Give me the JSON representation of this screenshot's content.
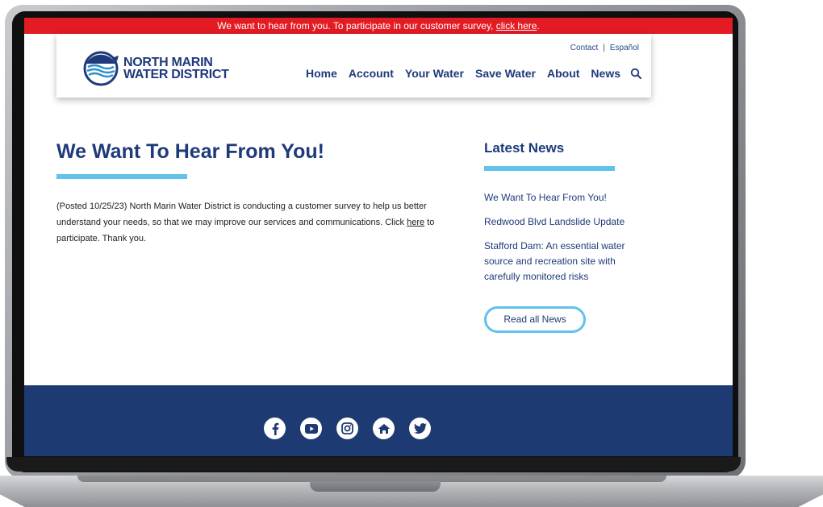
{
  "alert": {
    "text": "We want to hear from you. To participate in our customer survey, ",
    "link": "click here",
    "end": "."
  },
  "brand": {
    "line1": "NORTH MARIN",
    "line2": "WATER DISTRICT"
  },
  "utility_links": [
    "Contact",
    "Español"
  ],
  "nav": [
    "Home",
    "Account",
    "Your Water",
    "Save Water",
    "About",
    "News"
  ],
  "article": {
    "title": "We Want To Hear From You!",
    "body_start": "(Posted 10/25/23) North Marin Water District is conducting a customer survey to help us better understand your needs, so that we may improve our services and communications. Click ",
    "link": "here",
    "body_end": " to participate.  Thank you."
  },
  "sidebar": {
    "title": "Latest News",
    "items": [
      "We Want To Hear From You!",
      "Redwood Blvd Landslide Update",
      "Stafford Dam: An essential water source and recreation site with carefully monitored risks"
    ],
    "button": "Read all News"
  },
  "footer": {
    "socials": [
      "facebook-icon",
      "youtube-icon",
      "instagram-icon",
      "nextdoor-icon",
      "twitter-icon"
    ]
  },
  "colors": {
    "brand_blue": "#1e3a7a",
    "accent": "#61c2ec",
    "alert_red": "#e31b23",
    "footer_navy": "#1e3a72"
  }
}
